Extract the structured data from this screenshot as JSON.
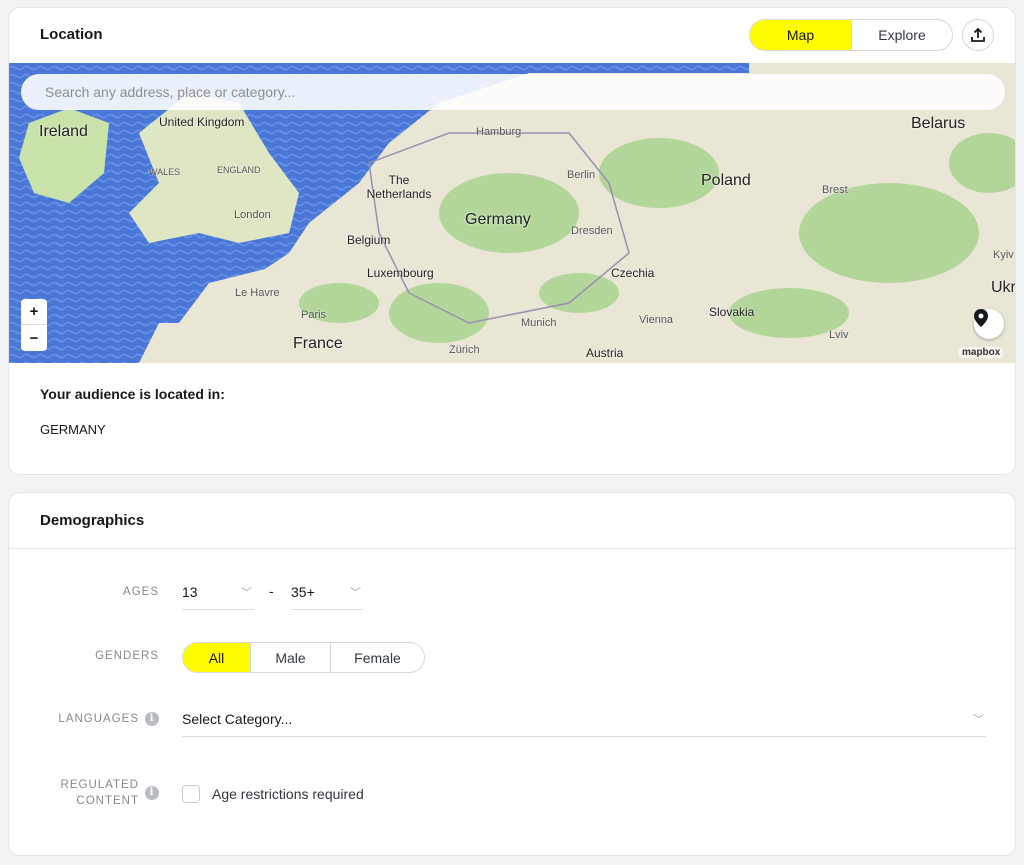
{
  "location": {
    "title": "Location",
    "tabs": [
      {
        "label": "Map",
        "active": true
      },
      {
        "label": "Explore",
        "active": false
      }
    ],
    "share_icon": "upload-icon",
    "search_placeholder": "Search any address, place or category...",
    "zoom_in": "+",
    "zoom_out": "−",
    "attribution": "mapbox",
    "map_labels": {
      "ireland": "Ireland",
      "uk": "United Kingdom",
      "wales": "WALES",
      "england": "ENGLAND",
      "london": "London",
      "hamburg": "Hamburg",
      "berlin": "Berlin",
      "the_netherlands": "The Netherlands",
      "germany": "Germany",
      "poland": "Poland",
      "belarus": "Belarus",
      "brest": "Brest",
      "belgium": "Belgium",
      "dresden": "Dresden",
      "luxembourg": "Luxembourg",
      "czechia": "Czechia",
      "le_havre": "Le Havre",
      "paris": "Paris",
      "france": "France",
      "munich": "Munich",
      "vienna": "Vienna",
      "slovakia": "Slovakia",
      "austria": "Austria",
      "zurich": "Zürich",
      "lviv": "Lviv",
      "kyiv": "Kyiv",
      "ukraine": "Ukr"
    },
    "audience_label": "Your audience is located in:",
    "audience_value": "GERMANY"
  },
  "demographics": {
    "title": "Demographics",
    "ages_label": "AGES",
    "age_min": "13",
    "age_sep": "-",
    "age_max": "35+",
    "genders_label": "GENDERS",
    "genders": [
      {
        "label": "All",
        "active": true
      },
      {
        "label": "Male",
        "active": false
      },
      {
        "label": "Female",
        "active": false
      }
    ],
    "languages_label": "LANGUAGES",
    "languages_placeholder": "Select Category...",
    "regulated_label_1": "REGULATED",
    "regulated_label_2": "CONTENT",
    "age_restriction_label": "Age restrictions required",
    "age_restriction_checked": false
  },
  "colors": {
    "accent": "#fffc00",
    "water": "#4a78d8",
    "land": "#e9e6d6",
    "forest": "#a9d48f"
  }
}
